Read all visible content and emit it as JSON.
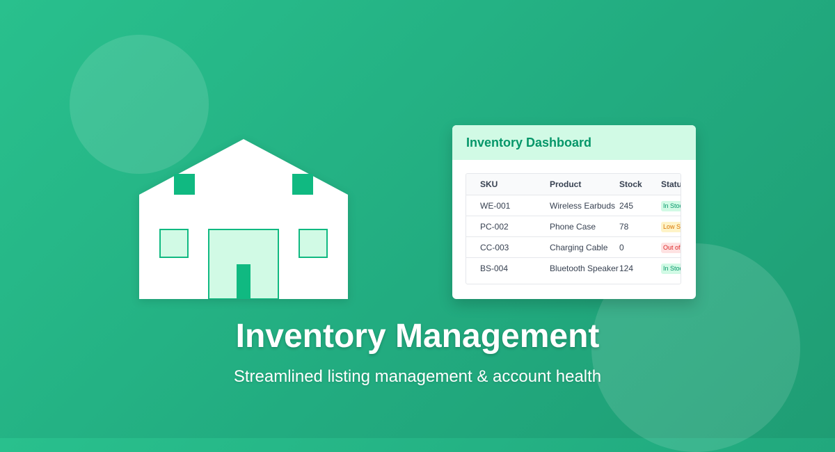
{
  "colors": {
    "background_start": "#29c08d",
    "background_end": "#1f9d74",
    "accent": "#10b981",
    "accent_dark": "#059669",
    "light_accent": "#d1fae5"
  },
  "illustration": {
    "icon": "warehouse-icon"
  },
  "dashboard": {
    "title": "Inventory Dashboard",
    "columns": [
      "SKU",
      "Product",
      "Stock",
      "Status"
    ],
    "rows": [
      {
        "sku": "WE-001",
        "product": "Wireless Earbuds",
        "stock": "245",
        "status": "In Stock",
        "status_type": "in"
      },
      {
        "sku": "PC-002",
        "product": "Phone Case",
        "stock": "78",
        "status": "Low Stock",
        "status_type": "low"
      },
      {
        "sku": "CC-003",
        "product": "Charging Cable",
        "stock": "0",
        "status": "Out of Stock",
        "status_type": "out"
      },
      {
        "sku": "BS-004",
        "product": "Bluetooth Speaker",
        "stock": "124",
        "status": "In Stock",
        "status_type": "in"
      }
    ]
  },
  "hero": {
    "title": "Inventory Management",
    "subtitle": "Streamlined listing management & account health"
  }
}
